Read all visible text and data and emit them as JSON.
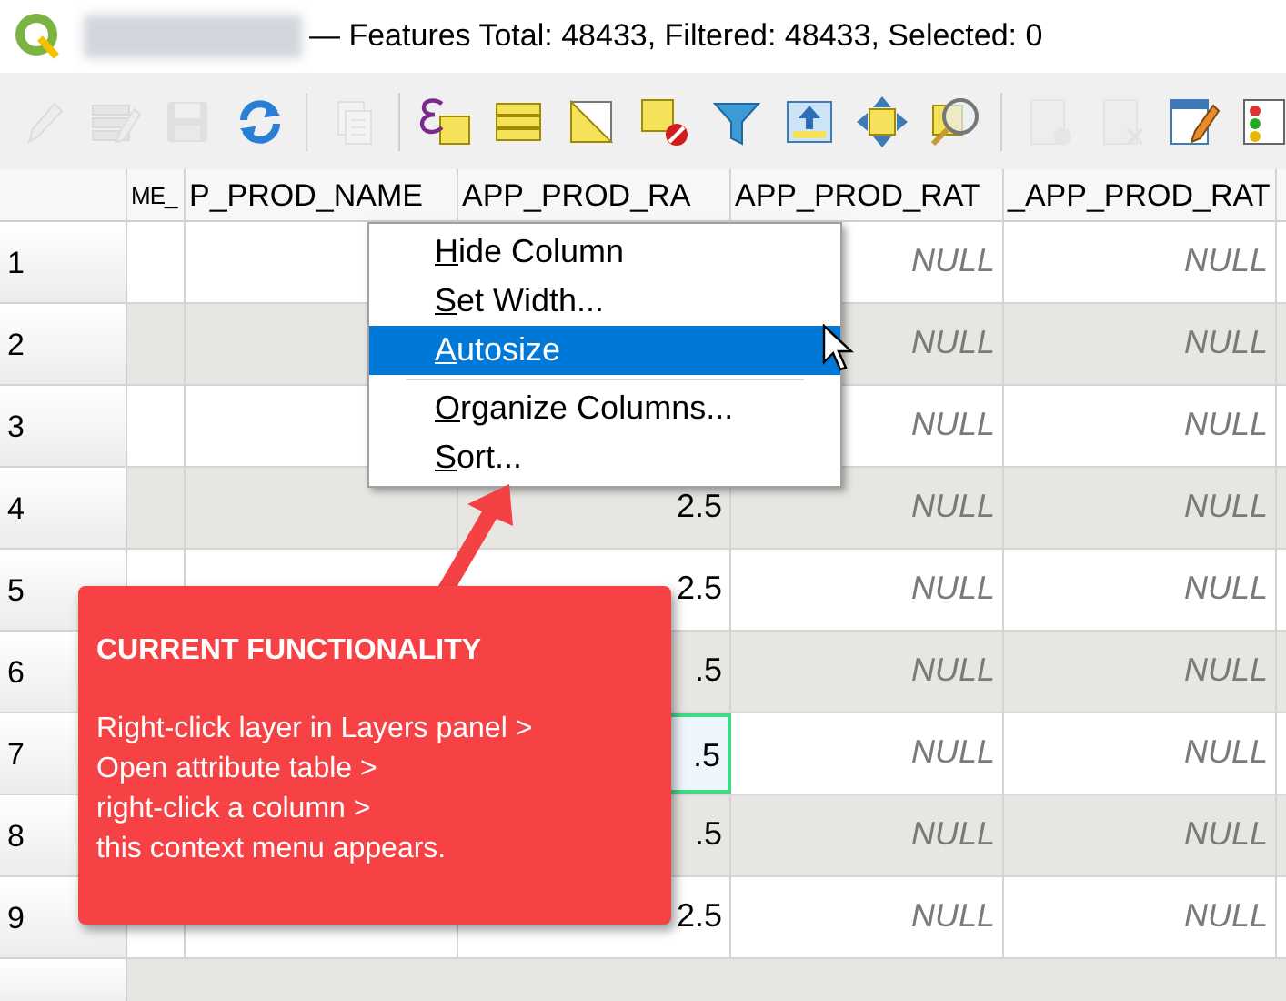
{
  "window": {
    "title": "— Features Total: 48433, Filtered: 48433, Selected: 0"
  },
  "toolbar": [
    {
      "kind": "pencil",
      "disabled": true
    },
    {
      "kind": "multi-edit",
      "disabled": true
    },
    {
      "kind": "save",
      "disabled": true
    },
    {
      "kind": "refresh",
      "disabled": false
    },
    {
      "kind": "separator"
    },
    {
      "kind": "paste",
      "disabled": true
    },
    {
      "kind": "separator"
    },
    {
      "kind": "expression-select",
      "disabled": false
    },
    {
      "kind": "select-all",
      "disabled": false
    },
    {
      "kind": "invert",
      "disabled": false
    },
    {
      "kind": "deselect",
      "disabled": false
    },
    {
      "kind": "filter",
      "disabled": false
    },
    {
      "kind": "move-top",
      "disabled": false
    },
    {
      "kind": "pan",
      "disabled": false
    },
    {
      "kind": "zoom",
      "disabled": false
    },
    {
      "kind": "separator"
    },
    {
      "kind": "new-field",
      "disabled": true
    },
    {
      "kind": "delete-field",
      "disabled": true
    },
    {
      "kind": "field-calculator",
      "disabled": false
    },
    {
      "kind": "formatting",
      "disabled": false
    }
  ],
  "table": {
    "columns": [
      "ME_",
      "P_PROD_NAME",
      "APP_PROD_RA",
      "APP_PROD_RAT",
      "_APP_PROD_RAT"
    ],
    "rows": [
      {
        "number": "1",
        "column_4": "NULL",
        "column_5": "NULL"
      },
      {
        "number": "2",
        "column_4": "NULL",
        "column_5": "NULL"
      },
      {
        "number": "3",
        "column_4": "NULL",
        "column_5": "NULL"
      },
      {
        "number": "4",
        "column_3": "2.5",
        "column_4": "NULL",
        "column_5": "NULL",
        "current": false
      },
      {
        "number": "5",
        "column_3": "2.5",
        "column_4": "NULL",
        "column_5": "NULL",
        "current": false
      },
      {
        "number": "6",
        "column_3": ".5",
        "column_4": "NULL",
        "column_5": "NULL",
        "current": false
      },
      {
        "number": "7",
        "column_3": ".5",
        "column_4": "NULL",
        "column_5": "NULL",
        "current": true
      },
      {
        "number": "8",
        "column_3": ".5",
        "column_4": "NULL",
        "column_5": "NULL",
        "current": false
      },
      {
        "number": "9",
        "column_3": "2.5",
        "column_4": "NULL",
        "column_5": "NULL",
        "current": false
      }
    ]
  },
  "context_menu": {
    "items": [
      {
        "label": "Hide Column",
        "selected": false,
        "separator_after": false
      },
      {
        "label": "Set Width...",
        "selected": false,
        "separator_after": false
      },
      {
        "label": "Autosize",
        "selected": true,
        "separator_after": true
      },
      {
        "label": "Organize Columns...",
        "selected": false,
        "separator_after": false
      },
      {
        "label": "Sort...",
        "selected": false,
        "separator_after": false
      }
    ]
  },
  "callout": {
    "title": "CURRENT FUNCTIONALITY",
    "lines": [
      "Right-click layer in Layers panel >",
      "Open attribute table >",
      "right-click a column >",
      "this context menu appears."
    ]
  }
}
